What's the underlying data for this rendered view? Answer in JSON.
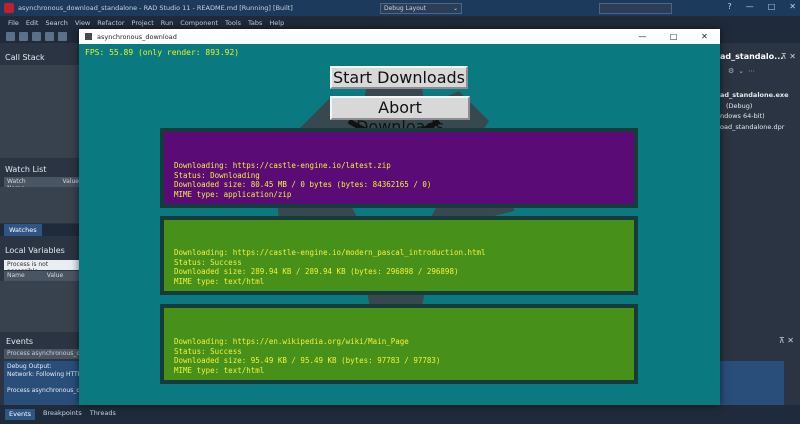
{
  "ide": {
    "title": "asynchronous_download_standalone - RAD Studio 11 - README.md [Running] [Built]",
    "layout_selector": "Debug Layout",
    "window_buttons": [
      "?",
      "—",
      "□",
      "✕"
    ],
    "menu": [
      "File",
      "Edit",
      "Search",
      "View",
      "Refactor",
      "Project",
      "Run",
      "Component",
      "Tools",
      "Tabs",
      "Help"
    ]
  },
  "left_panels": {
    "call_stack": "Call Stack",
    "watch_list": "Watch List",
    "watch_columns": [
      "Watch Name",
      "Value"
    ],
    "watches_tab": "Watches",
    "local_variables": "Local Variables",
    "process_message": "Process is not accessible",
    "local_columns": [
      "Name",
      "Value"
    ]
  },
  "events_panel": {
    "title": "Events",
    "first_row": "Process asynchronous_dow",
    "output_lines": [
      "Debug Output:",
      "Network: Following HTTP r",
      "",
      "Process asynchronous_dow"
    ],
    "tabs": [
      "Events",
      "Breakpoints",
      "Threads"
    ],
    "pin": "⊼ ✕"
  },
  "right_panel": {
    "title": "ad_standalo...",
    "pin": "⊼ ✕",
    "items": [
      {
        "text": "ad_standalone.exe",
        "bold": true
      },
      {
        "text": "(Debug)",
        "bold": false
      },
      {
        "text": "ndows 64-bit)",
        "bold": false
      },
      {
        "text": "oad_standalone.dpr",
        "bold": false
      }
    ]
  },
  "app": {
    "window_title": "asynchronous_download",
    "controls": [
      "—",
      "□",
      "✕"
    ],
    "fps": "FPS: 55.89 (only render: 893.92)",
    "start_button": "Start Downloads",
    "abort_button": "Abort Downloads",
    "downloads": [
      {
        "state": "downloading",
        "color": "#5a0b76",
        "line1": "Downloading: https://castle-engine.io/latest.zip",
        "line2": "Status: Downloading",
        "line3": "Downloaded size: 80.45 MB / 0 bytes (bytes: 84362165 / 0)",
        "line4": "MIME type: application/zip"
      },
      {
        "state": "success",
        "color": "#47901a",
        "line1": "Downloading: https://castle-engine.io/modern_pascal_introduction.html",
        "line2": "Status: Success",
        "line3": "Downloaded size: 289.94 KB / 289.94 KB (bytes: 296898 / 296898)",
        "line4": "MIME type: text/html"
      },
      {
        "state": "success",
        "color": "#47901a",
        "line1": "Downloading: https://en.wikipedia.org/wiki/Main_Page",
        "line2": "Status: Success",
        "line3": "Downloaded size: 95.49 KB / 95.49 KB (bytes: 97783 / 97783)",
        "line4": "MIME type: text/html"
      }
    ]
  }
}
